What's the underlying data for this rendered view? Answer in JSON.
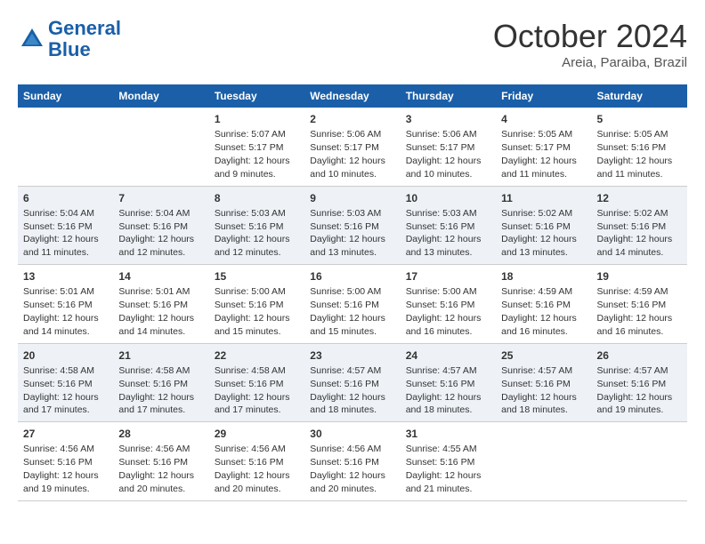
{
  "header": {
    "logo_line1": "General",
    "logo_line2": "Blue",
    "month": "October 2024",
    "location": "Areia, Paraiba, Brazil"
  },
  "days_of_week": [
    "Sunday",
    "Monday",
    "Tuesday",
    "Wednesday",
    "Thursday",
    "Friday",
    "Saturday"
  ],
  "weeks": [
    [
      {
        "day": "",
        "info": ""
      },
      {
        "day": "",
        "info": ""
      },
      {
        "day": "1",
        "info": "Sunrise: 5:07 AM\nSunset: 5:17 PM\nDaylight: 12 hours and 9 minutes."
      },
      {
        "day": "2",
        "info": "Sunrise: 5:06 AM\nSunset: 5:17 PM\nDaylight: 12 hours and 10 minutes."
      },
      {
        "day": "3",
        "info": "Sunrise: 5:06 AM\nSunset: 5:17 PM\nDaylight: 12 hours and 10 minutes."
      },
      {
        "day": "4",
        "info": "Sunrise: 5:05 AM\nSunset: 5:17 PM\nDaylight: 12 hours and 11 minutes."
      },
      {
        "day": "5",
        "info": "Sunrise: 5:05 AM\nSunset: 5:16 PM\nDaylight: 12 hours and 11 minutes."
      }
    ],
    [
      {
        "day": "6",
        "info": "Sunrise: 5:04 AM\nSunset: 5:16 PM\nDaylight: 12 hours and 11 minutes."
      },
      {
        "day": "7",
        "info": "Sunrise: 5:04 AM\nSunset: 5:16 PM\nDaylight: 12 hours and 12 minutes."
      },
      {
        "day": "8",
        "info": "Sunrise: 5:03 AM\nSunset: 5:16 PM\nDaylight: 12 hours and 12 minutes."
      },
      {
        "day": "9",
        "info": "Sunrise: 5:03 AM\nSunset: 5:16 PM\nDaylight: 12 hours and 13 minutes."
      },
      {
        "day": "10",
        "info": "Sunrise: 5:03 AM\nSunset: 5:16 PM\nDaylight: 12 hours and 13 minutes."
      },
      {
        "day": "11",
        "info": "Sunrise: 5:02 AM\nSunset: 5:16 PM\nDaylight: 12 hours and 13 minutes."
      },
      {
        "day": "12",
        "info": "Sunrise: 5:02 AM\nSunset: 5:16 PM\nDaylight: 12 hours and 14 minutes."
      }
    ],
    [
      {
        "day": "13",
        "info": "Sunrise: 5:01 AM\nSunset: 5:16 PM\nDaylight: 12 hours and 14 minutes."
      },
      {
        "day": "14",
        "info": "Sunrise: 5:01 AM\nSunset: 5:16 PM\nDaylight: 12 hours and 14 minutes."
      },
      {
        "day": "15",
        "info": "Sunrise: 5:00 AM\nSunset: 5:16 PM\nDaylight: 12 hours and 15 minutes."
      },
      {
        "day": "16",
        "info": "Sunrise: 5:00 AM\nSunset: 5:16 PM\nDaylight: 12 hours and 15 minutes."
      },
      {
        "day": "17",
        "info": "Sunrise: 5:00 AM\nSunset: 5:16 PM\nDaylight: 12 hours and 16 minutes."
      },
      {
        "day": "18",
        "info": "Sunrise: 4:59 AM\nSunset: 5:16 PM\nDaylight: 12 hours and 16 minutes."
      },
      {
        "day": "19",
        "info": "Sunrise: 4:59 AM\nSunset: 5:16 PM\nDaylight: 12 hours and 16 minutes."
      }
    ],
    [
      {
        "day": "20",
        "info": "Sunrise: 4:58 AM\nSunset: 5:16 PM\nDaylight: 12 hours and 17 minutes."
      },
      {
        "day": "21",
        "info": "Sunrise: 4:58 AM\nSunset: 5:16 PM\nDaylight: 12 hours and 17 minutes."
      },
      {
        "day": "22",
        "info": "Sunrise: 4:58 AM\nSunset: 5:16 PM\nDaylight: 12 hours and 17 minutes."
      },
      {
        "day": "23",
        "info": "Sunrise: 4:57 AM\nSunset: 5:16 PM\nDaylight: 12 hours and 18 minutes."
      },
      {
        "day": "24",
        "info": "Sunrise: 4:57 AM\nSunset: 5:16 PM\nDaylight: 12 hours and 18 minutes."
      },
      {
        "day": "25",
        "info": "Sunrise: 4:57 AM\nSunset: 5:16 PM\nDaylight: 12 hours and 18 minutes."
      },
      {
        "day": "26",
        "info": "Sunrise: 4:57 AM\nSunset: 5:16 PM\nDaylight: 12 hours and 19 minutes."
      }
    ],
    [
      {
        "day": "27",
        "info": "Sunrise: 4:56 AM\nSunset: 5:16 PM\nDaylight: 12 hours and 19 minutes."
      },
      {
        "day": "28",
        "info": "Sunrise: 4:56 AM\nSunset: 5:16 PM\nDaylight: 12 hours and 20 minutes."
      },
      {
        "day": "29",
        "info": "Sunrise: 4:56 AM\nSunset: 5:16 PM\nDaylight: 12 hours and 20 minutes."
      },
      {
        "day": "30",
        "info": "Sunrise: 4:56 AM\nSunset: 5:16 PM\nDaylight: 12 hours and 20 minutes."
      },
      {
        "day": "31",
        "info": "Sunrise: 4:55 AM\nSunset: 5:16 PM\nDaylight: 12 hours and 21 minutes."
      },
      {
        "day": "",
        "info": ""
      },
      {
        "day": "",
        "info": ""
      }
    ]
  ]
}
